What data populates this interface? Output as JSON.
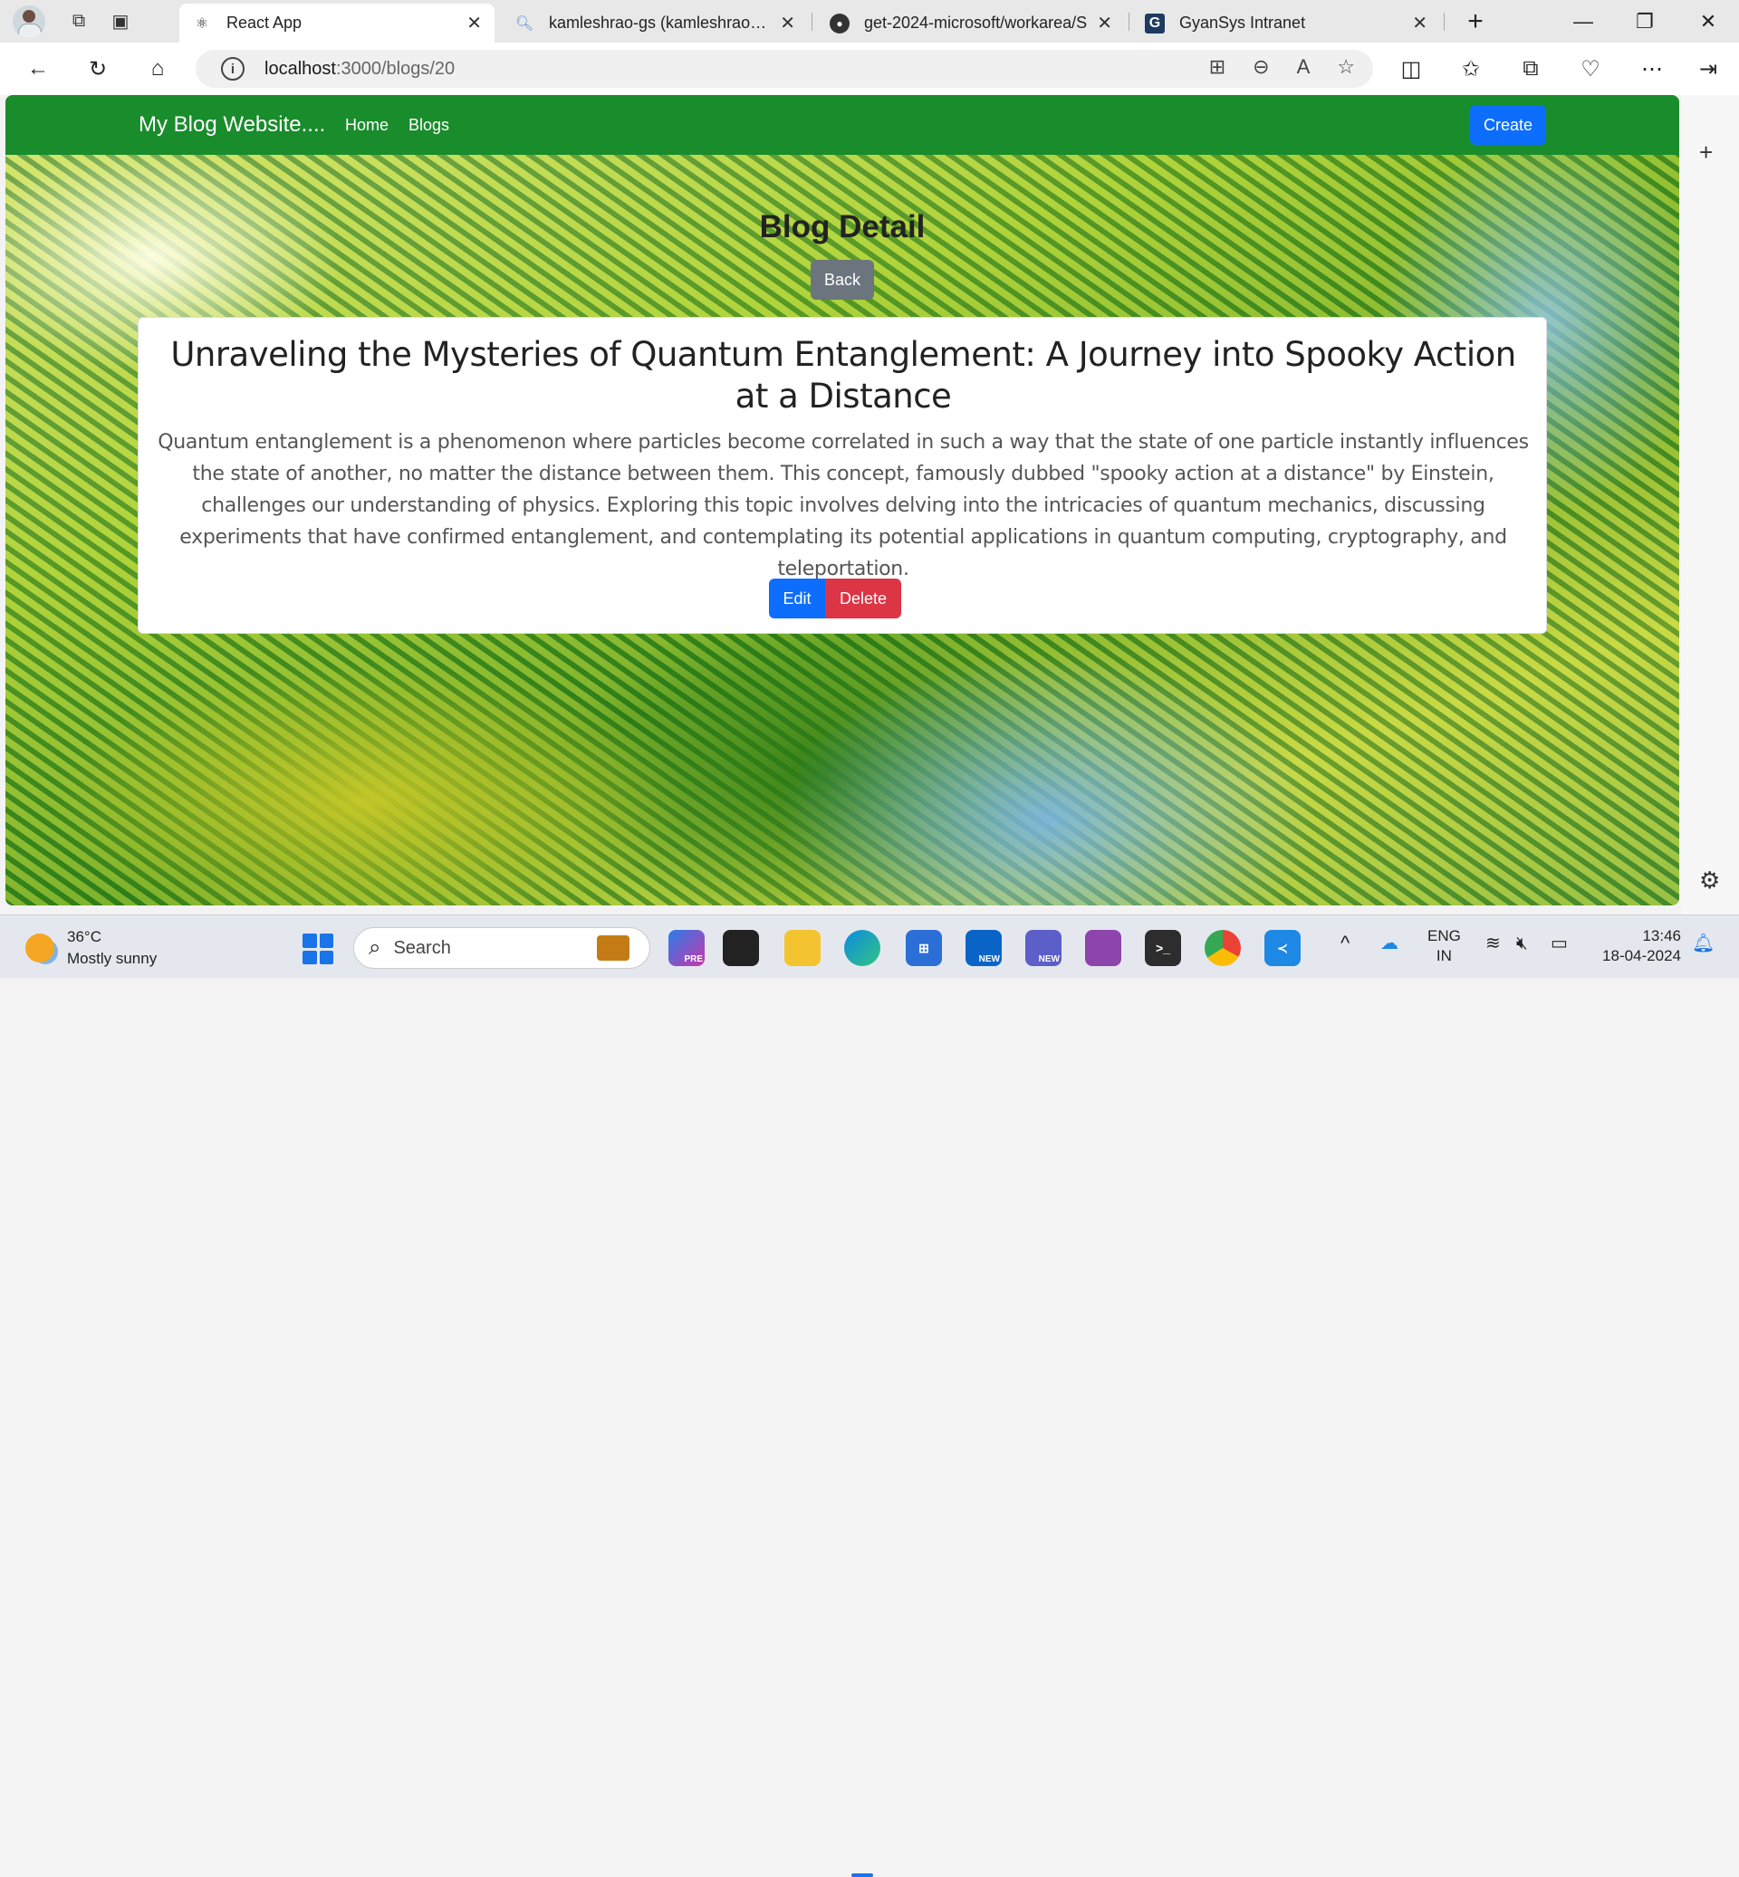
{
  "browser": {
    "tabs": [
      {
        "title": "React App",
        "favicon": "react-icon",
        "active": true
      },
      {
        "title": "kamleshrao-gs (kamleshrao-gs)",
        "favicon": "search-icon",
        "active": false
      },
      {
        "title": "get-2024-microsoft/workarea/S",
        "favicon": "github-icon",
        "active": false
      },
      {
        "title": "GyanSys Intranet",
        "favicon": "g-icon",
        "active": false
      }
    ],
    "url_host": "localhost",
    "url_rest": ":3000/blogs/20"
  },
  "app": {
    "brand": "My Blog Website....",
    "nav_home": "Home",
    "nav_blogs": "Blogs",
    "create_label": "Create",
    "page_heading": "Blog Detail",
    "back_label": "Back",
    "blog": {
      "title": "Unraveling the Mysteries of Quantum Entanglement: A Journey into Spooky Action at a Distance",
      "body": "Quantum entanglement is a phenomenon where particles become correlated in such a way that the state of one particle instantly influences the state of another, no matter the distance between them. This concept, famously dubbed \"spooky action at a distance\" by Einstein, challenges our understanding of physics. Exploring this topic involves delving into the intricacies of quantum mechanics, discussing experiments that have confirmed entanglement, and contemplating its potential applications in quantum computing, cryptography, and teleportation."
    },
    "edit_label": "Edit",
    "delete_label": "Delete",
    "colors": {
      "navbar": "#198c2c",
      "primary": "#0d6efd",
      "secondary": "#6c757d",
      "danger": "#dc3545"
    }
  },
  "taskbar": {
    "weather_temp": "36°C",
    "weather_desc": "Mostly sunny",
    "search_label": "Search",
    "lang_line1": "ENG",
    "lang_line2": "IN",
    "time": "13:46",
    "date": "18-04-2024",
    "copilot_badge": "PRE",
    "outlook_badge": "NEW",
    "teams_badge": "NEW"
  }
}
